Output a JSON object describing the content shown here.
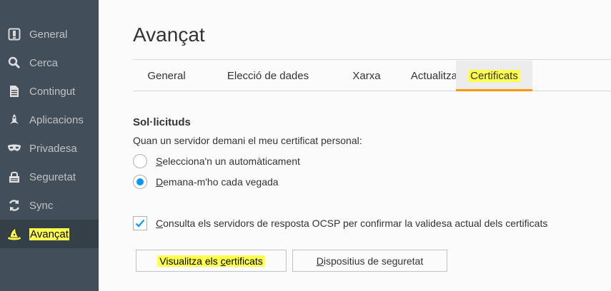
{
  "sidebar": {
    "items": [
      {
        "label": "General",
        "icon": "general-icon"
      },
      {
        "label": "Cerca",
        "icon": "search-icon"
      },
      {
        "label": "Contingut",
        "icon": "document-icon"
      },
      {
        "label": "Aplicacions",
        "icon": "rocket-icon"
      },
      {
        "label": "Privadesa",
        "icon": "mask-icon"
      },
      {
        "label": "Seguretat",
        "icon": "lock-icon"
      },
      {
        "label": "Sync",
        "icon": "sync-icon"
      },
      {
        "label": "Avançat",
        "icon": "wizard-hat-icon",
        "selected": true
      }
    ]
  },
  "page": {
    "title": "Avançat"
  },
  "tabs": [
    {
      "label": "General"
    },
    {
      "label": "Elecció de dades"
    },
    {
      "label": "Xarxa"
    },
    {
      "label": "Actualització"
    },
    {
      "label": "Certificats",
      "selected": true
    }
  ],
  "requests": {
    "heading": "Sol·licituds",
    "prompt": "Quan un servidor demani el meu certificat personal:",
    "option_auto_first": "S",
    "option_auto_rest": "elecciona'n un automàticament",
    "option_ask_first": "D",
    "option_ask_rest": "emana-m'ho cada vegada",
    "selected_option": "ask"
  },
  "ocsp": {
    "first": "C",
    "rest": "onsulta els servidors de resposta OCSP per confirmar la validesa actual dels certificats",
    "checked": true
  },
  "buttons": {
    "view_pre": "Visualitza els ",
    "view_accel": "c",
    "view_post": "ertificats",
    "devices_accel": "D",
    "devices_post": "ispositius de seguretat"
  },
  "colors": {
    "sidebar_bg": "#424f5a",
    "sidebar_selected_bg": "#343f48",
    "highlight": "#ffff4d",
    "tab_accent": "#ff9500",
    "radio_checked": "#0996f8"
  }
}
